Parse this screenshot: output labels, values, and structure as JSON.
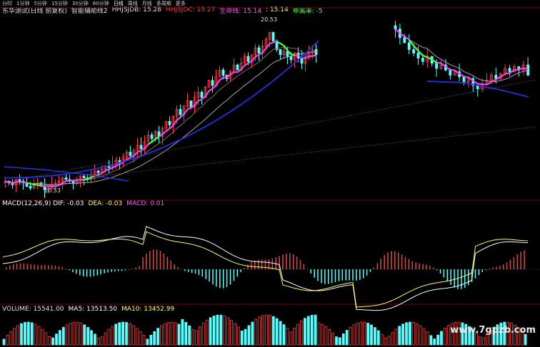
{
  "toolbar": {
    "items": [
      "分时",
      "1分钟",
      "5分钟",
      "15分钟",
      "30分钟",
      "60分钟",
      "日线",
      "周线",
      "月线",
      "多周期",
      "更多"
    ],
    "active_index": 6
  },
  "main": {
    "title": "东华测试(日线 前复权)",
    "indicator_name": "智能辅助线2",
    "hhjsjdb_label": "HHJSJDB: 15.28",
    "hhjsjdc_label": "HHJSJDC: 15.27",
    "lifeline_label": "生命线: 15.14",
    "v4_label": ": 15.14",
    "drop_rate_label": "乖离率: -5",
    "high_label": "20.53",
    "low_label": "10.53",
    "colors": {
      "title": "#e0e0e0",
      "hhjsjdb": "#e0e0e0",
      "hhjsjdc": "#ff3b3b",
      "lifeline": "#ff55ff",
      "v4": "#ffff55",
      "drop": "#55ff55"
    }
  },
  "macd": {
    "label": "MACD(12,26,9) DIF: -0.03",
    "dea_label": "DEA: -0.03",
    "macd_label": "MACD: 0.01",
    "colors": {
      "dif": "#ffffff",
      "dea": "#ffff55",
      "macd": "#ff55ff"
    }
  },
  "volume": {
    "label": "VOLUME: 15541.00",
    "ma5_label": "MA5: 13513.50",
    "ma10_label": "MA10: 13452.99",
    "colors": {
      "vol": "#e0e0e0",
      "ma5": "#ffffff",
      "ma10": "#ffff55"
    }
  },
  "watermark": "www.7gpzb.com",
  "chart_data": {
    "type": "candlestick",
    "price_range": [
      10.53,
      20.53
    ],
    "close": [
      11.1,
      11.0,
      10.9,
      11.2,
      11.1,
      11.0,
      10.8,
      10.7,
      10.9,
      11.0,
      10.8,
      10.6,
      10.7,
      10.9,
      11.0,
      11.1,
      11.3,
      11.2,
      11.1,
      11.0,
      11.2,
      11.4,
      11.3,
      11.2,
      11.5,
      11.7,
      11.6,
      11.8,
      12.0,
      11.9,
      12.1,
      12.3,
      12.2,
      12.5,
      12.8,
      12.6,
      12.9,
      13.2,
      13.0,
      13.4,
      13.8,
      13.6,
      14.0,
      13.7,
      14.2,
      14.6,
      14.4,
      14.9,
      15.3,
      15.0,
      15.5,
      15.8,
      15.4,
      16.0,
      16.3,
      16.0,
      16.6,
      17.0,
      16.7,
      17.2,
      17.6,
      17.3,
      17.1,
      17.5,
      17.9,
      17.6,
      18.0,
      18.4,
      18.1,
      18.5,
      18.9,
      18.6,
      19.0,
      19.4,
      19.8,
      19.3,
      18.8,
      18.5,
      18.7,
      18.4,
      18.2,
      18.6,
      18.3,
      18.0,
      18.4,
      18.6,
      18.8,
      18.5
    ]
  }
}
